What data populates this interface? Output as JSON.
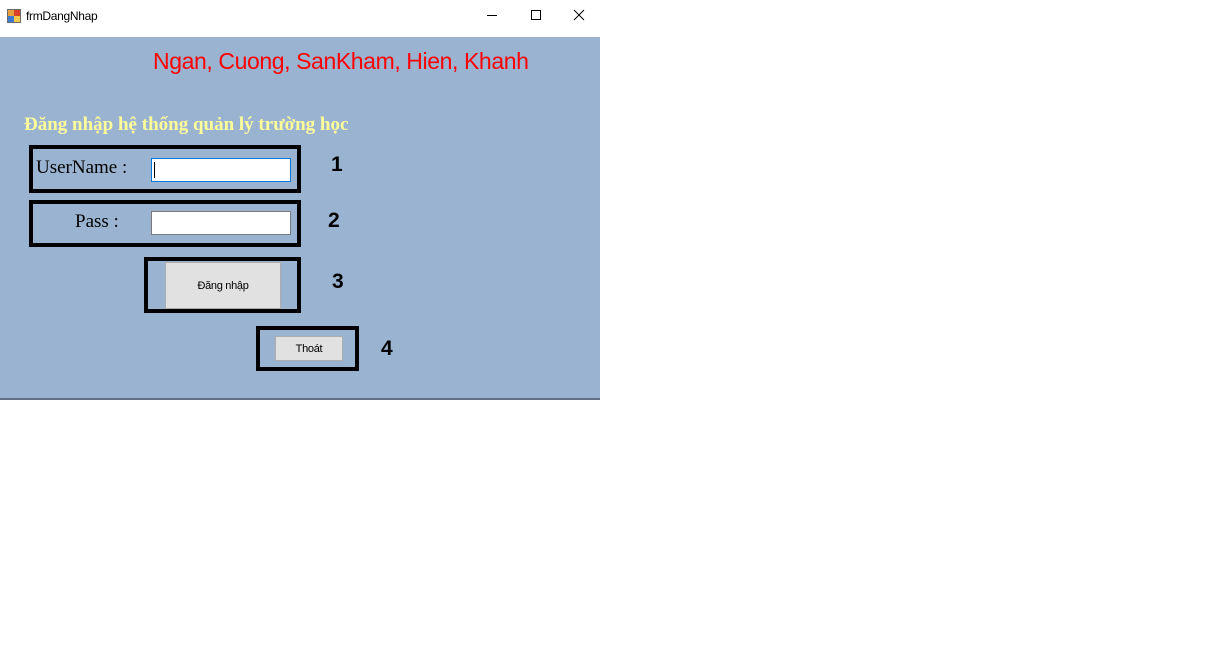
{
  "window": {
    "title": "frmDangNhap",
    "icons": {
      "app": "app-form-icon",
      "minimize": "minimize-icon",
      "maximize": "maximize-icon",
      "close": "close-icon"
    }
  },
  "form": {
    "members_label": "Ngan, Cuong, SanKham, Hien, Khanh",
    "system_title": "Đăng nhập hệ thống quản lý trường học",
    "username": {
      "label": "UserName :",
      "value": ""
    },
    "password": {
      "label": "Pass :",
      "value": ""
    },
    "login_button_label": "Đăng nhập",
    "exit_button_label": "Thoát"
  },
  "annotations": {
    "n1": "1",
    "n2": "2",
    "n3": "3",
    "n4": "4"
  },
  "colors": {
    "client_background": "#9ab3d1",
    "members_label": "#ff0000",
    "system_title": "#ffff99",
    "highlight_box": "#000000"
  }
}
